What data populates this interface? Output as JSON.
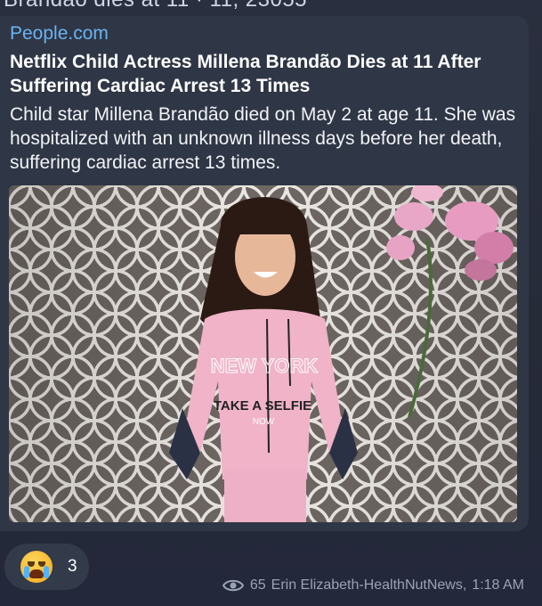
{
  "prev_message_fragment": "Brandão dies at 11 · 11, 23055",
  "preview": {
    "source": "People.com",
    "headline": "Netflix Child Actress Millena Brandão Dies at 11 After Suffering Cardiac Arrest 13 Times",
    "description": "Child star Millena Brandão died on May 2 at age 11. She was hospitalized with an unknown illness days before her death, suffering cardiac arrest 13 times.",
    "image_text": {
      "line1": "NEW YORK",
      "line2": "TAKE A SELFIE",
      "line3": "NOW"
    }
  },
  "reaction": {
    "emoji": "loudly-crying-face",
    "count": "3"
  },
  "meta": {
    "views": "65",
    "author": "Erin Elizabeth-HealthNutNews,",
    "time": "1:18 AM"
  },
  "colors": {
    "link": "#6ab3f3",
    "bubble": "#2f3645",
    "background": "#262b38"
  }
}
